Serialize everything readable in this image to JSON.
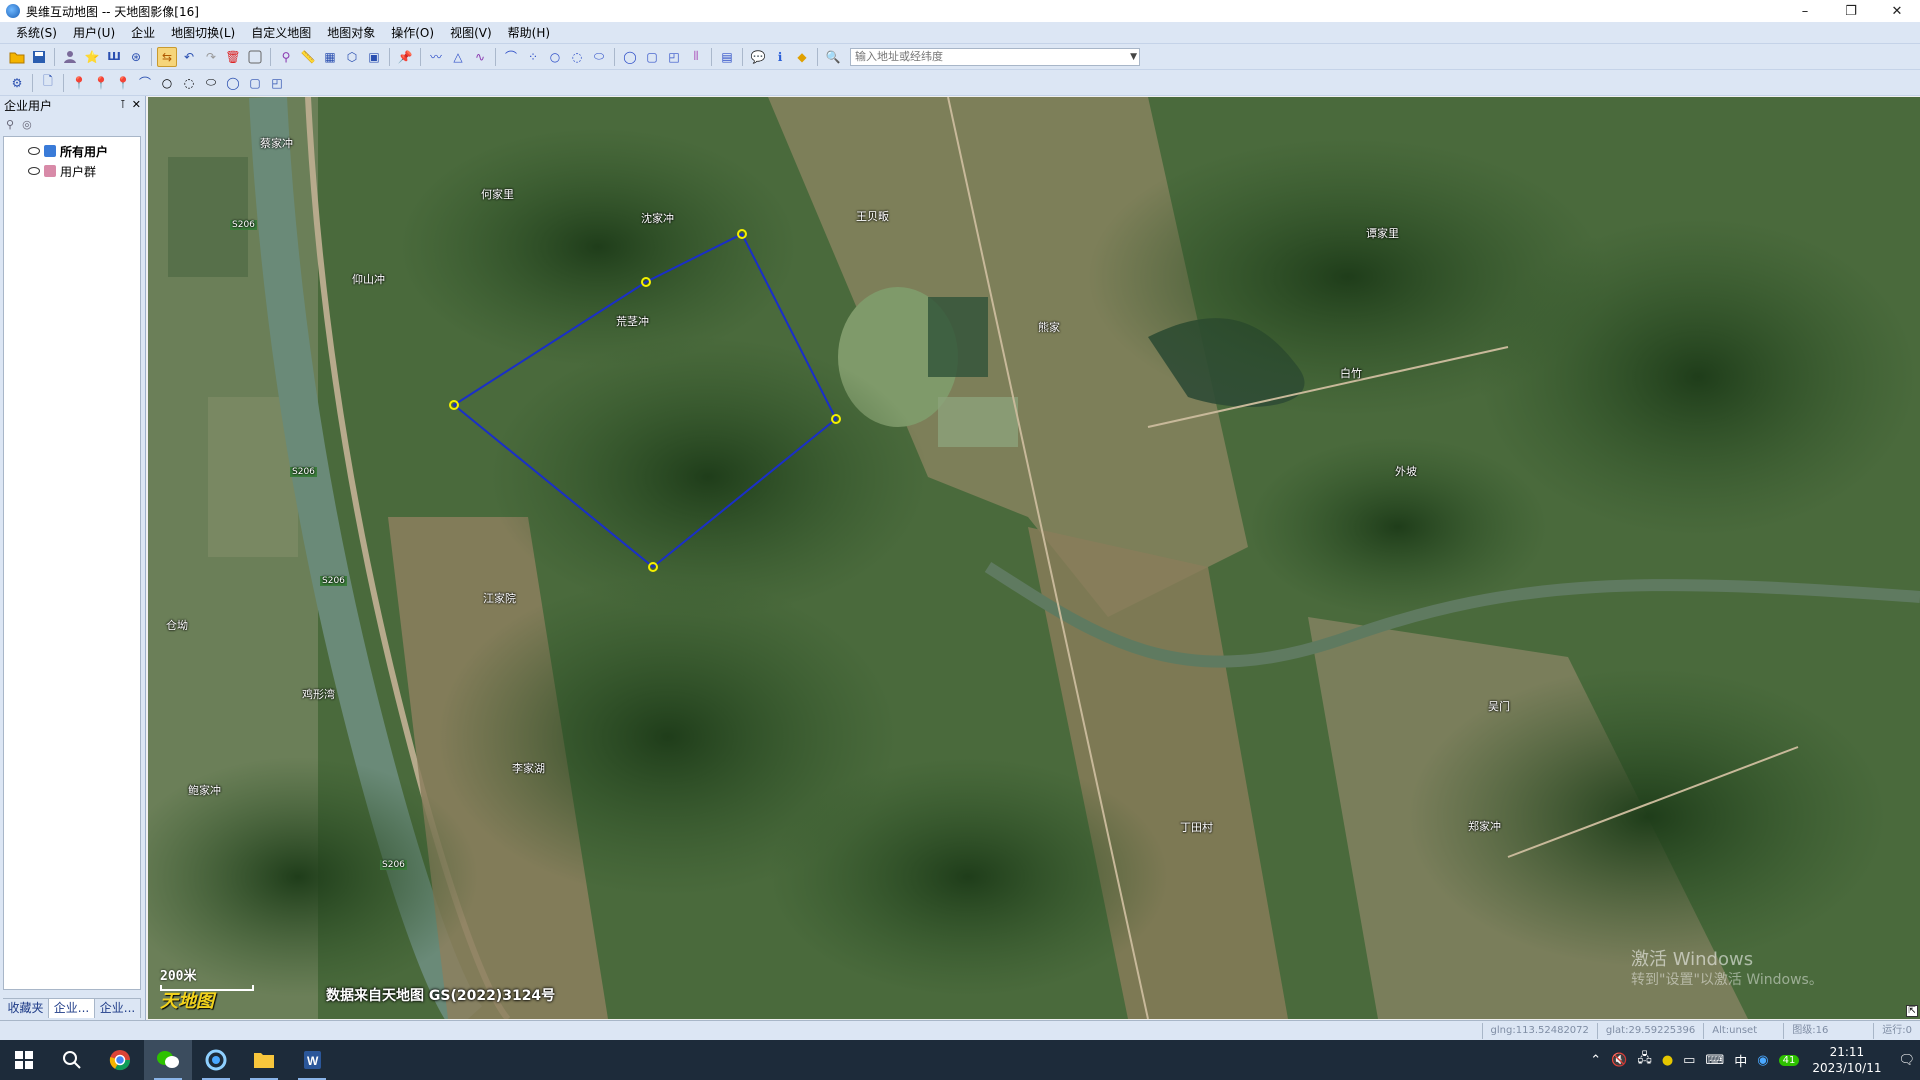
{
  "window": {
    "title": "奥维互动地图 -- 天地图影像[16]",
    "controls": [
      "–",
      "❐",
      "✕"
    ]
  },
  "menu": [
    "系统(S)",
    "用户(U)",
    "企业",
    "地图切换(L)",
    "自定义地图",
    "地图对象",
    "操作(O)",
    "视图(V)",
    "帮助(H)"
  ],
  "toolbar": {
    "search_placeholder": "输入地址或经纬度"
  },
  "sidepanel": {
    "title": "企业用户",
    "pin_icon": "pin-icon",
    "close_icon": "close-icon",
    "tree": [
      {
        "label": "所有用户",
        "selected": true
      },
      {
        "label": "用户群",
        "selected": false
      }
    ],
    "tabs": [
      "收藏夹",
      "企业...",
      "企业..."
    ]
  },
  "map": {
    "labels": [
      {
        "text": "蔡家冲"
      },
      {
        "text": "何家里"
      },
      {
        "text": "沈家冲"
      },
      {
        "text": "王贝畈"
      },
      {
        "text": "谭家里"
      },
      {
        "text": "仰山冲"
      },
      {
        "text": "荒茎冲"
      },
      {
        "text": "熊家"
      },
      {
        "text": "白竹"
      },
      {
        "text": "外坡"
      },
      {
        "text": "江家院"
      },
      {
        "text": "仓坳"
      },
      {
        "text": "鸡形湾"
      },
      {
        "text": "李家湖"
      },
      {
        "text": "鲍家冲"
      },
      {
        "text": "吴门"
      },
      {
        "text": "郑家冲"
      },
      {
        "text": "丁田村"
      },
      {
        "text": "S206"
      },
      {
        "text": "S206"
      },
      {
        "text": "S206"
      },
      {
        "text": "S206"
      }
    ],
    "polygon_color": "#1a2fc8",
    "vertex_color": "#f5f000",
    "scale": "200米",
    "logo": "天地图",
    "attribution": "数据来自天地图 GS(2022)3124号",
    "watermark_line1": "激活 Windows",
    "watermark_line2": "转到\"设置\"以激活 Windows。"
  },
  "status": {
    "lng": "glng:113.52482072",
    "lat": "glat:29.59225396",
    "alt": "Alt:unset",
    "zoom": "图级:16",
    "run": "运行:0"
  },
  "taskbar": {
    "time": "21:11",
    "date": "2023/10/11",
    "ime": "中",
    "badge": "41"
  }
}
